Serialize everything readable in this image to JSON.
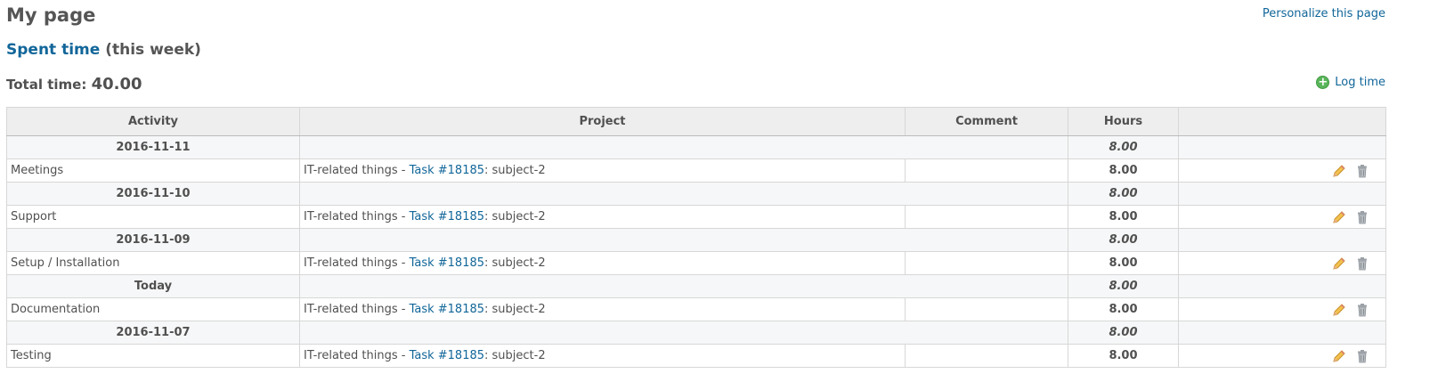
{
  "page": {
    "title": "My page",
    "personalize_label": "Personalize this page"
  },
  "spent_time": {
    "link_label": "Spent time",
    "period_label": "(this week)",
    "total_label": "Total time:",
    "total_value": "40.00",
    "log_time_label": "Log time"
  },
  "table": {
    "headers": {
      "activity": "Activity",
      "project": "Project",
      "comment": "Comment",
      "hours": "Hours"
    },
    "groups": [
      {
        "date": "2016-11-11",
        "day_hours": "8.00",
        "entry": {
          "activity": "Meetings",
          "project": "IT-related things",
          "separator": " - ",
          "issue_link": "Task #18185",
          "issue_subject": ": subject-2",
          "comment": "",
          "hours": "8.00"
        }
      },
      {
        "date": "2016-11-10",
        "day_hours": "8.00",
        "entry": {
          "activity": "Support",
          "project": "IT-related things",
          "separator": " - ",
          "issue_link": "Task #18185",
          "issue_subject": ": subject-2",
          "comment": "",
          "hours": "8.00"
        }
      },
      {
        "date": "2016-11-09",
        "day_hours": "8.00",
        "entry": {
          "activity": "Setup / Installation",
          "project": "IT-related things",
          "separator": " - ",
          "issue_link": "Task #18185",
          "issue_subject": ": subject-2",
          "comment": "",
          "hours": "8.00"
        }
      },
      {
        "date": "Today",
        "day_hours": "8.00",
        "entry": {
          "activity": "Documentation",
          "project": "IT-related things",
          "separator": " - ",
          "issue_link": "Task #18185",
          "issue_subject": ": subject-2",
          "comment": "",
          "hours": "8.00"
        }
      },
      {
        "date": "2016-11-07",
        "day_hours": "8.00",
        "entry": {
          "activity": "Testing",
          "project": "IT-related things",
          "separator": " - ",
          "issue_link": "Task #18185",
          "issue_subject": ": subject-2",
          "comment": "",
          "hours": "8.00"
        }
      }
    ]
  },
  "icons": {
    "edit": "pencil-icon",
    "delete": "trash-icon",
    "log_time": "add-icon"
  },
  "colors": {
    "link": "#116699",
    "header_bg": "#eeeeee",
    "date_row_bg": "#f6f7f8",
    "add_icon": "#5ab55a"
  }
}
